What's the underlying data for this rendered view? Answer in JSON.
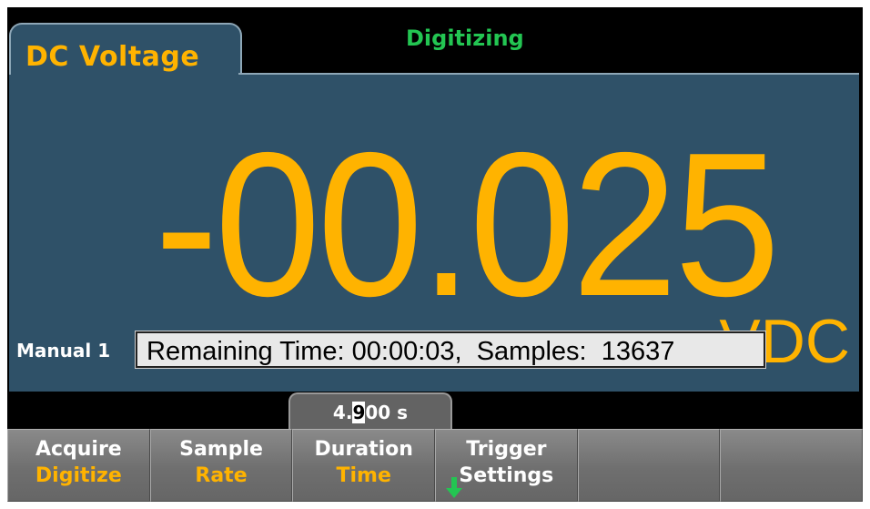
{
  "header": {
    "function_label": "DC Voltage",
    "status": "Digitizing"
  },
  "display": {
    "reading": "-00.025",
    "unit": "VDC",
    "trigger_mode": "Manual 1",
    "message": "Remaining Time: 00:00:03,  Samples:  13637"
  },
  "value_entry": {
    "before_cursor": "4.",
    "cursor_digit": "9",
    "after_cursor": "00 s"
  },
  "softkeys": [
    {
      "line1": "Acquire",
      "line2": "Digitize"
    },
    {
      "line1": "Sample",
      "line2": "Rate"
    },
    {
      "line1": "Duration",
      "line2": "Time"
    },
    {
      "line1": "Trigger",
      "line2": "Settings"
    },
    {
      "line1": "",
      "line2": ""
    },
    {
      "line1": "",
      "line2": ""
    }
  ],
  "colors": {
    "panel": "#2f5168",
    "accent": "#ffb300",
    "status": "#23c552",
    "arrow": "#23c552"
  },
  "icons": {
    "trigger_settings_arrow": "down-arrow-icon"
  }
}
